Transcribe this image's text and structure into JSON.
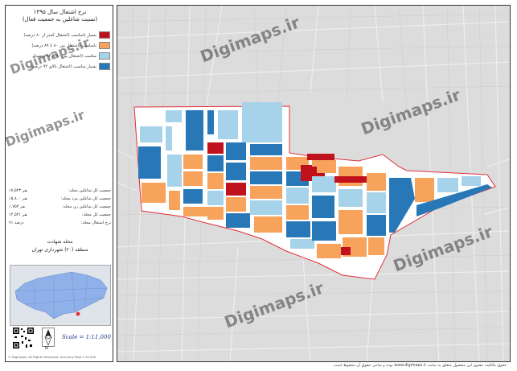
{
  "title": {
    "line1": "نرخ اشتغال سال ۱۳۹۵",
    "line2": "(نسبت شاغلین به جمعیت فعال)"
  },
  "legend": [
    {
      "label": "بسیار نامناسب (اشتغال کمتر از ۸۰ درصد)",
      "color": "#c0121c"
    },
    {
      "label": "نامناسب (اشتغال بین ۸۰ تا ۸۹ درصد)",
      "color": "#f7a35c"
    },
    {
      "label": "مناسب (اشتغال بین ۹۰ تا ۹۴ درصد)",
      "color": "#a7d3ea"
    },
    {
      "label": "بسیار مناسب (اشتغال بالای ۹۴ درصد)",
      "color": "#2878b8"
    }
  ],
  "stats": [
    {
      "label": "جمعیت کل شاغلین محله:",
      "value": "۱۷,۵۴۳ نفر"
    },
    {
      "label": "جمعیت کل شاغلین مرد محله:",
      "value": "۱۵,۸۰۰ نفر"
    },
    {
      "label": "جمعیت کل شاغلین زن محله:",
      "value": "۱,۷۵۳ نفر"
    },
    {
      "label": "جمعیت کل محله:",
      "value": "۱۴,۵۳۱ نفر"
    },
    {
      "label": "نرخ اشتغال محله:",
      "value": "۹۱ درصد"
    }
  ],
  "district": {
    "line1": "محله شهادت",
    "line2": "منطقه (۲۰) شهرداری تهران"
  },
  "scale": "Scale = 1:11,000",
  "north": "N",
  "credit": "© Digimaps. All Rights Reserved, Accuracy Map 1:10,000",
  "footer": "حقوق مالکیت معنوی این محصول متعلق به سایت www.digimaps.ir بوده و تمامی حقوق آن محفوظ است.",
  "watermark": "Digimaps.ir",
  "colors": {
    "very_poor": "#c0121c",
    "poor": "#f7a35c",
    "good": "#a7d3ea",
    "very_good": "#2878b8",
    "boundary": "#e0303a",
    "base": "#dcdcdc",
    "inset_fill": "#8fb0e8"
  }
}
